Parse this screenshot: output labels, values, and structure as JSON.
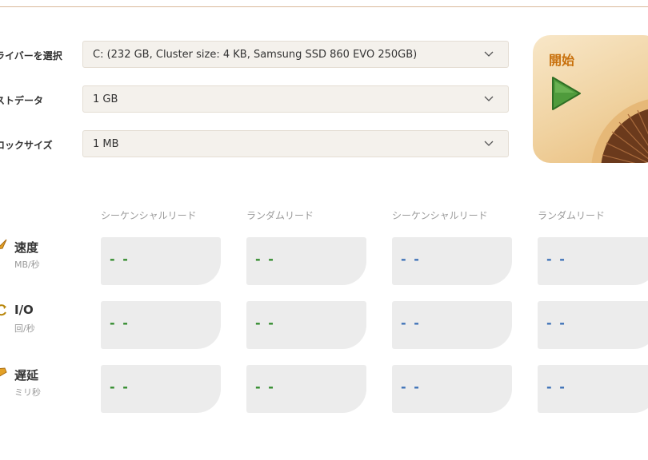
{
  "fields": {
    "drive": {
      "label": "ライバーを選択",
      "value": "C: (232 GB, Cluster size: 4 KB, Samsung SSD 860 EVO 250GB)"
    },
    "test_data": {
      "label": "ストデータ",
      "value": "1 GB"
    },
    "block_size": {
      "label": "ロックサイズ",
      "value": "1 MB"
    }
  },
  "start": {
    "label": "開始"
  },
  "columns": [
    "シーケンシャルリード",
    "ランダムリード",
    "シーケンシャルリード",
    "ランダムリード"
  ],
  "rows": [
    {
      "title": "速度",
      "unit": "MB/秒",
      "values": [
        "- -",
        "- -",
        "- -",
        "- -"
      ]
    },
    {
      "title": "I/O",
      "unit": "回/秒",
      "values": [
        "- -",
        "- -",
        "- -",
        "- -"
      ]
    },
    {
      "title": "遅延",
      "unit": "ミリ秒",
      "values": [
        "- -",
        "- -",
        "- -",
        "- -"
      ]
    }
  ],
  "colors": {
    "accent": "#c8700c",
    "read_value": "#2f8a2a",
    "write_value": "#3a6fb6",
    "cell_bg": "#ececec"
  },
  "icons": {
    "dropdown": "chevron-down-icon",
    "start": "play-icon",
    "speed": "speed-icon",
    "io": "io-icon",
    "latency": "latency-icon"
  }
}
